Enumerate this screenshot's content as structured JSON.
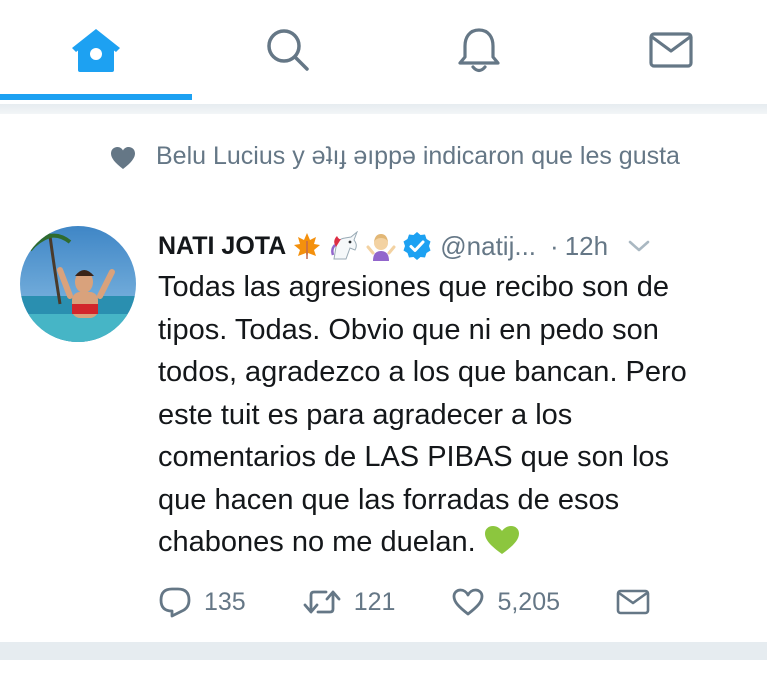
{
  "colors": {
    "accent": "#1da1f2",
    "icon_gray": "#657786",
    "text": "#14171a",
    "green_heart": "#77b255"
  },
  "nav": {
    "tabs": [
      {
        "icon": "home-icon",
        "active": true
      },
      {
        "icon": "search-icon",
        "active": false
      },
      {
        "icon": "bell-icon",
        "active": false
      },
      {
        "icon": "mail-icon",
        "active": false
      }
    ]
  },
  "tweet": {
    "social_context": {
      "icon": "heart-icon",
      "text": "Belu Lucius y ǝʇıɟ ǝıppǝ indicaron que les gusta"
    },
    "author": {
      "name": "NATI JOTA",
      "emoji_icons": [
        "maple-leaf-icon",
        "unicorn-icon",
        "woman-shrugging-icon"
      ],
      "verified": true,
      "handle": "@natij...",
      "separator": "·",
      "time": "12h"
    },
    "text_lines": [
      "Todas las agresiones que recibo son de",
      "tipos. Todas. Obvio que ni en pedo son",
      "todos, agradezco a los que bancan. Pero",
      "este tuit es para agradecer a los",
      "comentarios de LAS PIBAS que son los",
      "que hacen que las forradas de esos",
      "chabones no me duelan."
    ],
    "actions": {
      "reply_count": "135",
      "retweet_count": "121",
      "like_count": "5,205"
    }
  }
}
